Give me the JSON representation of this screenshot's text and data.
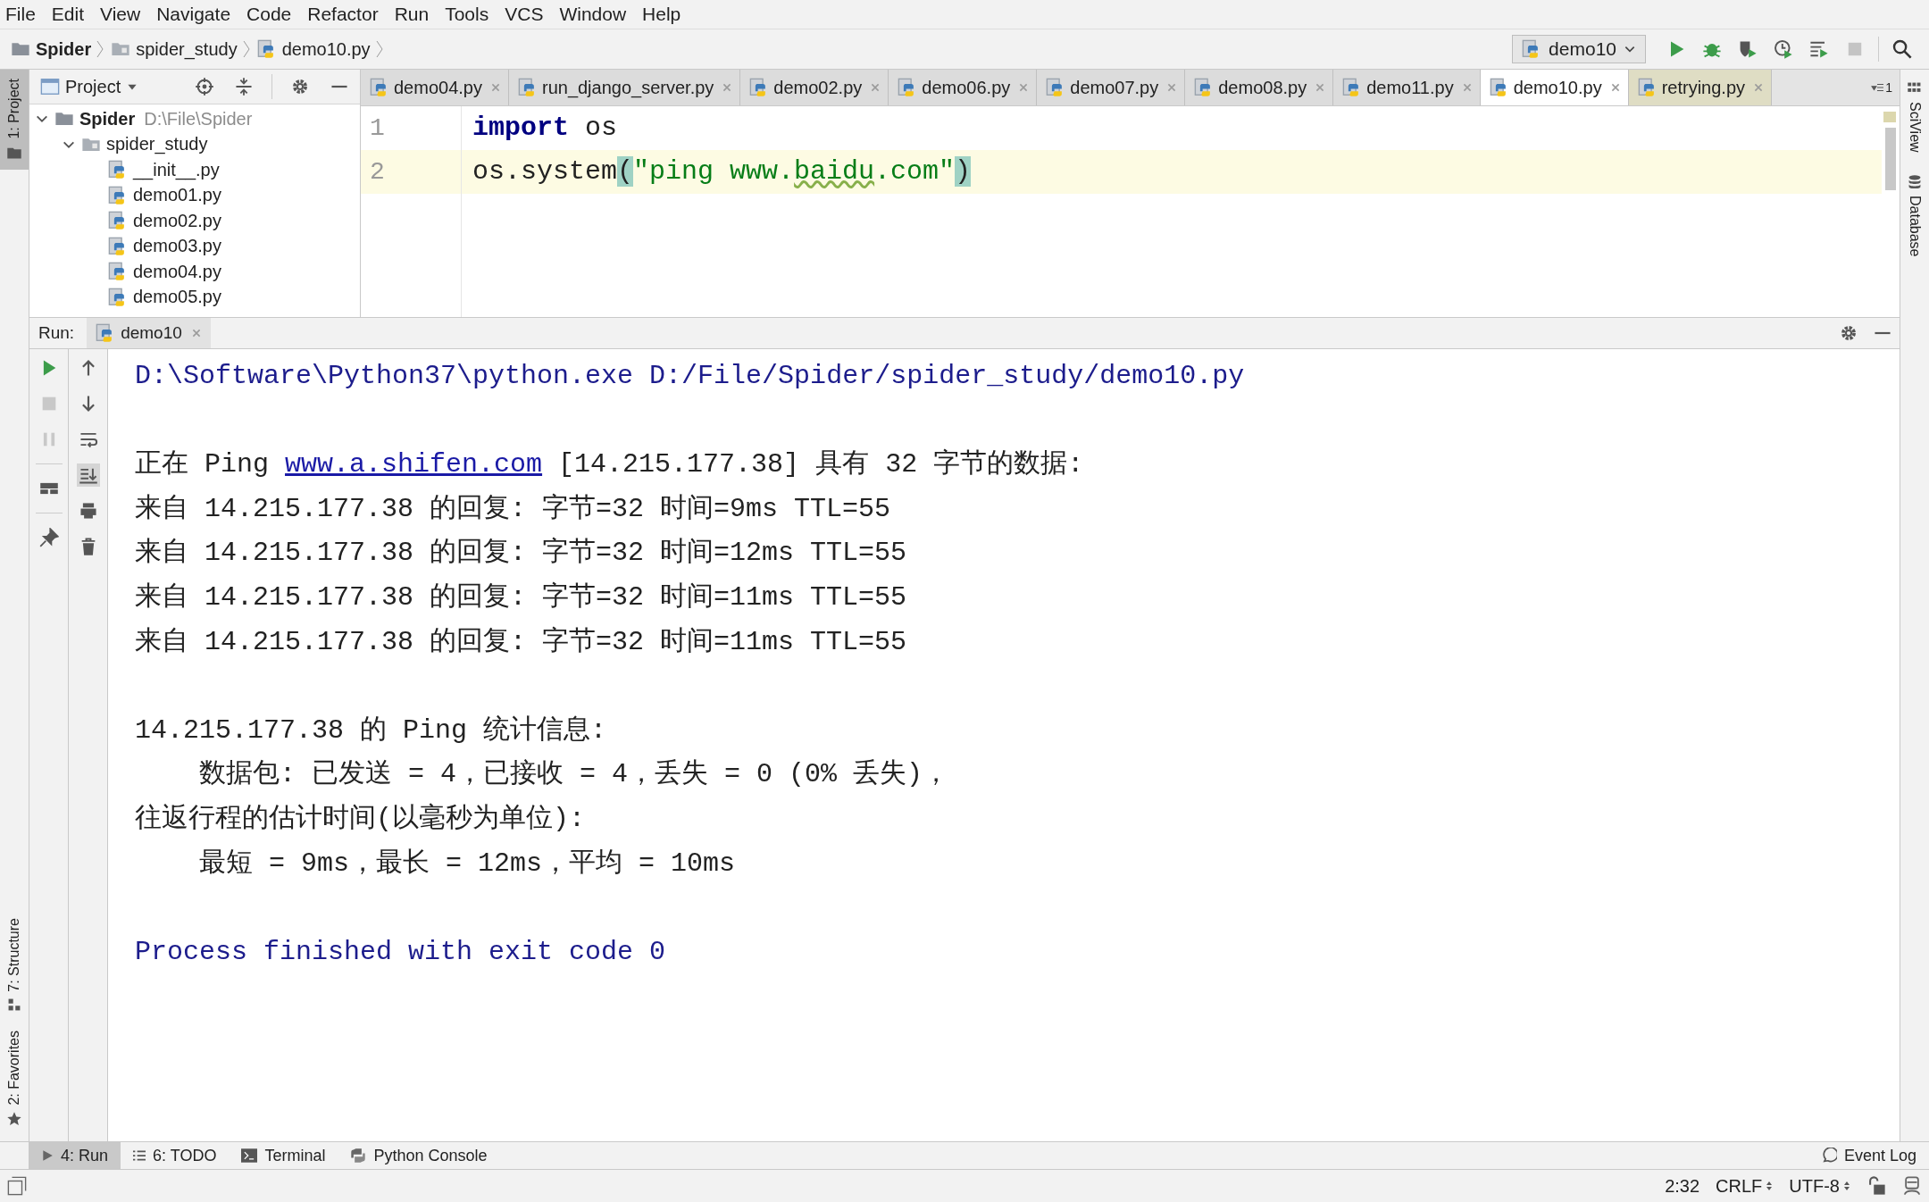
{
  "menu": [
    "File",
    "Edit",
    "View",
    "Navigate",
    "Code",
    "Refactor",
    "Run",
    "Tools",
    "VCS",
    "Window",
    "Help"
  ],
  "breadcrumbs": [
    {
      "label": "Spider",
      "kind": "project"
    },
    {
      "label": "spider_study",
      "kind": "folder"
    },
    {
      "label": "demo10.py",
      "kind": "file"
    }
  ],
  "run_config": "demo10",
  "left_stripe": [
    {
      "label": "1: Project",
      "selected": true,
      "kind": "project"
    },
    {
      "label": "7: Structure",
      "selected": false,
      "kind": "structure"
    },
    {
      "label": "2: Favorites",
      "selected": false,
      "kind": "favorites"
    }
  ],
  "right_stripe": [
    {
      "label": "SciView",
      "kind": "sciview"
    },
    {
      "label": "Database",
      "kind": "database"
    }
  ],
  "project_panel": {
    "title": "Project",
    "tree": [
      {
        "label": "Spider",
        "path": "D:\\File\\Spider",
        "kind": "project",
        "expanded": true,
        "children": [
          {
            "label": "spider_study",
            "kind": "folder",
            "expanded": true,
            "children": [
              {
                "label": "__init__.py",
                "kind": "file"
              },
              {
                "label": "demo01.py",
                "kind": "file"
              },
              {
                "label": "demo02.py",
                "kind": "file"
              },
              {
                "label": "demo03.py",
                "kind": "file"
              },
              {
                "label": "demo04.py",
                "kind": "file"
              },
              {
                "label": "demo05.py",
                "kind": "file"
              }
            ]
          }
        ]
      }
    ]
  },
  "tabs": [
    {
      "label": "demo04.py",
      "selected": false,
      "kind": "project"
    },
    {
      "label": "run_django_server.py",
      "selected": false,
      "kind": "project"
    },
    {
      "label": "demo02.py",
      "selected": false,
      "kind": "project"
    },
    {
      "label": "demo06.py",
      "selected": false,
      "kind": "project"
    },
    {
      "label": "demo07.py",
      "selected": false,
      "kind": "project"
    },
    {
      "label": "demo08.py",
      "selected": false,
      "kind": "project"
    },
    {
      "label": "demo11.py",
      "selected": false,
      "kind": "project"
    },
    {
      "label": "demo10.py",
      "selected": true,
      "kind": "project"
    },
    {
      "label": "retrying.py",
      "selected": false,
      "kind": "library"
    }
  ],
  "hidden_tabs_count": "1",
  "editor": {
    "lines": [
      {
        "number": "1",
        "current": false,
        "tokens": [
          {
            "text": "import",
            "kind": "keyword"
          },
          {
            "text": " os",
            "kind": "plain"
          }
        ]
      },
      {
        "number": "2",
        "current": true,
        "tokens": [
          {
            "text": "os.system",
            "kind": "plain"
          },
          {
            "text": "(",
            "kind": "brace"
          },
          {
            "text": "\"ping www.",
            "kind": "string"
          },
          {
            "text": "baidu",
            "kind": "typo"
          },
          {
            "text": ".com\"",
            "kind": "string"
          },
          {
            "text": ")",
            "kind": "brace"
          }
        ]
      }
    ]
  },
  "run_panel": {
    "label": "Run:",
    "tab": "demo10",
    "console": [
      {
        "kind": "command",
        "segments": [
          {
            "text": "D:\\Software\\Python37\\python.exe D:/File/Spider/spider_study/demo10.py",
            "link": false
          }
        ]
      },
      {
        "kind": "blank"
      },
      {
        "kind": "output",
        "segments": [
          {
            "text": "正在 Ping ",
            "link": false
          },
          {
            "text": "www.a.shifen.com",
            "link": true
          },
          {
            "text": " [14.215.177.38] 具有 32 字节的数据:",
            "link": false
          }
        ]
      },
      {
        "kind": "output",
        "segments": [
          {
            "text": "来自 14.215.177.38 的回复: 字节=32 时间=9ms TTL=55",
            "link": false
          }
        ]
      },
      {
        "kind": "output",
        "segments": [
          {
            "text": "来自 14.215.177.38 的回复: 字节=32 时间=12ms TTL=55",
            "link": false
          }
        ]
      },
      {
        "kind": "output",
        "segments": [
          {
            "text": "来自 14.215.177.38 的回复: 字节=32 时间=11ms TTL=55",
            "link": false
          }
        ]
      },
      {
        "kind": "output",
        "segments": [
          {
            "text": "来自 14.215.177.38 的回复: 字节=32 时间=11ms TTL=55",
            "link": false
          }
        ]
      },
      {
        "kind": "blank"
      },
      {
        "kind": "output",
        "segments": [
          {
            "text": "14.215.177.38 的 Ping 统计信息:",
            "link": false
          }
        ]
      },
      {
        "kind": "output",
        "segments": [
          {
            "text": "    数据包: 已发送 = 4，已接收 = 4，丢失 = 0 (0% 丢失)，",
            "link": false
          }
        ]
      },
      {
        "kind": "output",
        "segments": [
          {
            "text": "往返行程的估计时间(以毫秒为单位):",
            "link": false
          }
        ]
      },
      {
        "kind": "output",
        "segments": [
          {
            "text": "    最短 = 9ms，最长 = 12ms，平均 = 10ms",
            "link": false
          }
        ]
      },
      {
        "kind": "blank"
      },
      {
        "kind": "command",
        "segments": [
          {
            "text": "Process finished with exit code 0",
            "link": false
          }
        ]
      }
    ]
  },
  "tool_tabs": [
    {
      "label": "4: Run",
      "selected": true,
      "kind": "run"
    },
    {
      "label": "6: TODO",
      "selected": false,
      "kind": "todo"
    },
    {
      "label": "Terminal",
      "selected": false,
      "kind": "terminal"
    },
    {
      "label": "Python Console",
      "selected": false,
      "kind": "console"
    }
  ],
  "event_log": "Event Log",
  "status_bar": {
    "position": "2:32",
    "line_separator": "CRLF",
    "encoding": "UTF-8"
  }
}
